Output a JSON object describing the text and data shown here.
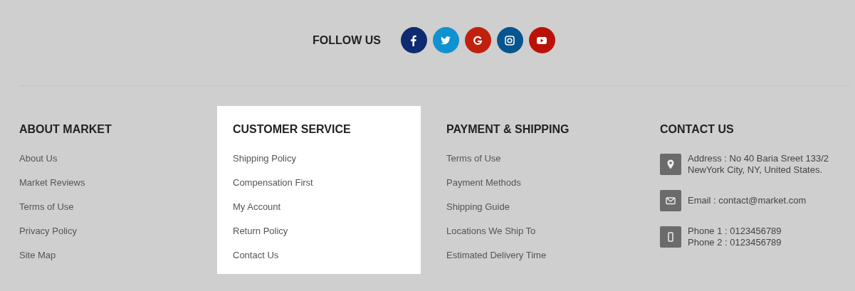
{
  "follow": {
    "title": "FOLLOW US",
    "networks": [
      {
        "kind": "facebook",
        "color": "#0d2b6e"
      },
      {
        "kind": "twitter",
        "color": "#1192d0"
      },
      {
        "kind": "google",
        "color": "#c1200f"
      },
      {
        "kind": "instagram",
        "color": "#07558f"
      },
      {
        "kind": "youtube",
        "color": "#bb1208"
      }
    ]
  },
  "columns": [
    {
      "title": "ABOUT MARKET",
      "selected": false,
      "links": [
        "About Us",
        "Market Reviews",
        "Terms of Use",
        "Privacy Policy",
        "Site Map"
      ]
    },
    {
      "title": "CUSTOMER SERVICE",
      "selected": true,
      "links": [
        "Shipping Policy",
        "Compensation First",
        "My Account",
        "Return Policy",
        "Contact Us"
      ]
    },
    {
      "title": "PAYMENT & SHIPPING",
      "selected": false,
      "links": [
        "Terms of Use",
        "Payment Methods",
        "Shipping Guide",
        "Locations We Ship To",
        "Estimated Delivery Time"
      ]
    }
  ],
  "contact": {
    "title": "CONTACT US",
    "items": [
      {
        "kind": "address",
        "lines": [
          "Address : No 40 Baria Sreet 133/2",
          "NewYork City, NY, United States."
        ]
      },
      {
        "kind": "email",
        "lines": [
          "Email : contact@market.com"
        ]
      },
      {
        "kind": "phone",
        "lines": [
          "Phone 1 : 0123456789",
          "Phone 2 : 0123456789"
        ]
      }
    ]
  }
}
